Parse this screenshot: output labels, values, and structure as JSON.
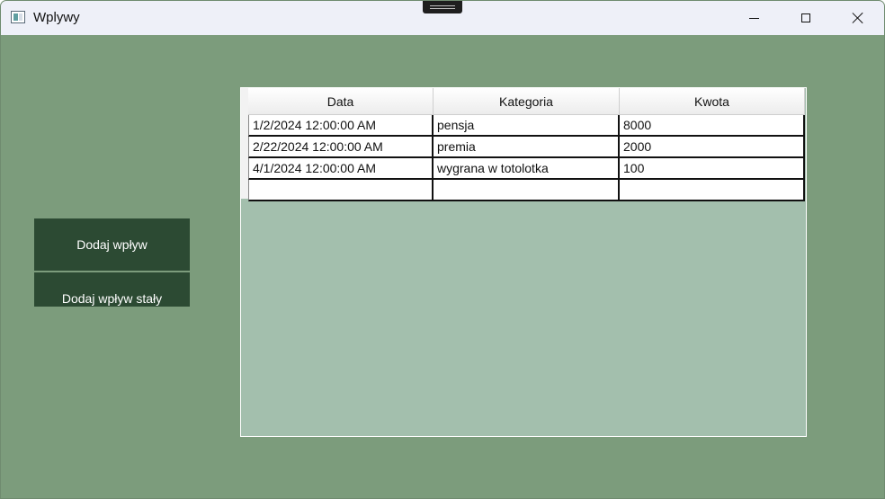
{
  "window": {
    "title": "Wplywy"
  },
  "titlebar": {
    "app_icon": "window-app-icon",
    "minimize_icon": "minimize-icon",
    "maximize_icon": "maximize-icon",
    "close_icon": "close-icon"
  },
  "actions": {
    "add_label": "Dodaj wpływ",
    "add_fixed_label": "Dodaj wpływ stały"
  },
  "grid": {
    "columns": [
      "Data",
      "Kategoria",
      "Kwota"
    ],
    "rows": [
      [
        "1/2/2024 12:00:00 AM",
        "pensja",
        "8000"
      ],
      [
        "2/22/2024 12:00:00 AM",
        "premia",
        "2000"
      ],
      [
        "4/1/2024 12:00:00 AM",
        "wygrana w totolotka",
        "100"
      ],
      [
        "",
        "",
        ""
      ]
    ]
  },
  "colors": {
    "window_background": "#7c9c7c",
    "button_background": "#2c4a33",
    "grid_background": "#a3bfad"
  }
}
